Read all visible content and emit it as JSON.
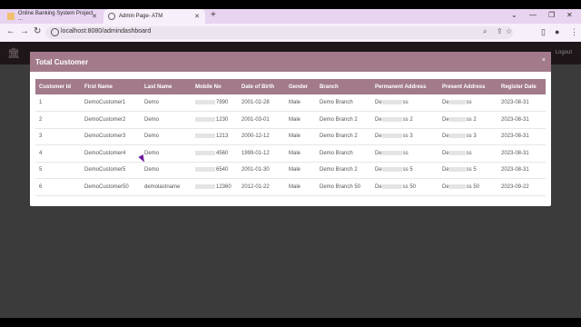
{
  "browser": {
    "tabs": [
      {
        "title": "Online Banking System Project ..."
      },
      {
        "title": "Admin Page- ATM"
      }
    ],
    "url": "localhost:8080/admindashboard"
  },
  "app": {
    "logout_label": "Logout"
  },
  "modal": {
    "title": "Total Customer",
    "close": "×"
  },
  "table": {
    "headers": [
      "Customer Id",
      "First Name",
      "Last Name",
      "Mobile No",
      "Date of Birth",
      "Gender",
      "Branch",
      "Permanent Address",
      "Present Address",
      "Register Date"
    ],
    "rows": [
      {
        "id": "1",
        "first": "DemoCustomer1",
        "last": "Demo",
        "mobile": "7890",
        "dob": "2001-02-28",
        "gender": "Male",
        "branch": "Demo Branch",
        "perm_a": "De",
        "perm_b": "ss",
        "pres_a": "De",
        "pres_b": "ss",
        "reg": "2023-08-31"
      },
      {
        "id": "2",
        "first": "DemoCustomer2",
        "last": "Demo",
        "mobile": "1230",
        "dob": "2001-03-01",
        "gender": "Male",
        "branch": "Demo Branch 2",
        "perm_a": "De",
        "perm_b": "ss 2",
        "pres_a": "De",
        "pres_b": "ss 2",
        "reg": "2023-08-31"
      },
      {
        "id": "3",
        "first": "DemoCustomer3",
        "last": "Demo",
        "mobile": "1213",
        "dob": "2000-12-12",
        "gender": "Male",
        "branch": "Demo Branch 2",
        "perm_a": "De",
        "perm_b": "ss 3",
        "pres_a": "De",
        "pres_b": "ss 3",
        "reg": "2023-08-31"
      },
      {
        "id": "4",
        "first": "DemoCustomer4",
        "last": "Demo",
        "mobile": "4560",
        "dob": "1999-01-12",
        "gender": "Male",
        "branch": "Demo Branch",
        "perm_a": "De",
        "perm_b": "ss",
        "pres_a": "De",
        "pres_b": "ss",
        "reg": "2023-08-31"
      },
      {
        "id": "5",
        "first": "DemoCustomer5",
        "last": "Demo",
        "mobile": "6540",
        "dob": "2001-01-30",
        "gender": "Male",
        "branch": "Demo Branch 2",
        "perm_a": "De",
        "perm_b": "ss 5",
        "pres_a": "De",
        "pres_b": "ss 5",
        "reg": "2023-08-31"
      },
      {
        "id": "6",
        "first": "DemoCustomer50",
        "last": "demolastname",
        "mobile": "12360",
        "dob": "2012-01-22",
        "gender": "Male",
        "branch": "Demo Branch 50",
        "perm_a": "De",
        "perm_b": "ss 50",
        "pres_a": "De",
        "pres_b": "ss 50",
        "reg": "2023-09-22"
      }
    ]
  }
}
